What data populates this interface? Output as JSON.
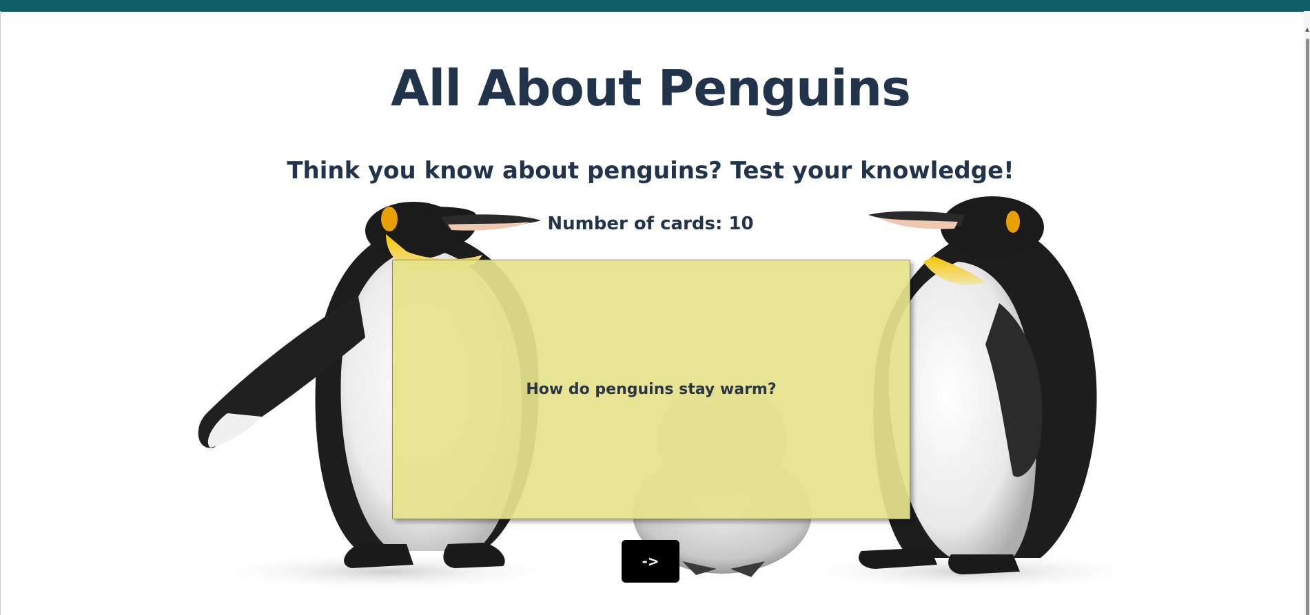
{
  "page": {
    "title": "All About Penguins",
    "subtitle": "Think you know about penguins? Test your knowledge!",
    "card_count_label": "Number of cards: 10"
  },
  "card": {
    "question": "How do penguins stay warm?"
  },
  "controls": {
    "next_label": "->"
  },
  "colors": {
    "heading": "#22344b",
    "card_background": "#e5e38b",
    "button_background": "#000000",
    "top_strip": "#0f5d66"
  },
  "icons": {
    "background": "penguins-illustration"
  }
}
